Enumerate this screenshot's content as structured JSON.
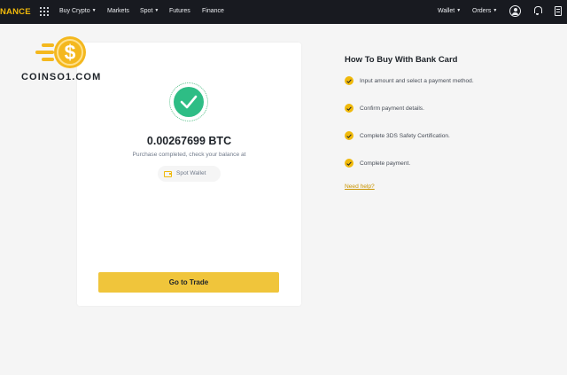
{
  "brand": "NANCE",
  "nav": {
    "items": [
      {
        "label": "Buy Crypto",
        "caret": true
      },
      {
        "label": "Markets",
        "caret": false
      },
      {
        "label": "Spot",
        "caret": true
      },
      {
        "label": "Futures",
        "caret": false
      },
      {
        "label": "Finance",
        "caret": false
      }
    ],
    "wallet": "Wallet",
    "orders": "Orders",
    "caret_glyph": "▼"
  },
  "watermark": {
    "text": "COINSO1.COM",
    "icon_symbol": "$"
  },
  "result": {
    "amount": "0.00267699 BTC",
    "message": "Purchase completed, check your balance at",
    "wallet_button": "Spot Wallet",
    "trade_button": "Go to Trade"
  },
  "howto": {
    "title": "How To Buy With Bank Card",
    "steps": [
      "Input amount and select a payment method.",
      "Confirm payment details.",
      "Complete 3DS Safety Certification.",
      "Complete payment."
    ],
    "help_link": "Need help?"
  },
  "colors": {
    "accent": "#f0b90b",
    "success": "#2ebd85",
    "topbar_bg": "#181a20",
    "button": "#f0c53b"
  }
}
